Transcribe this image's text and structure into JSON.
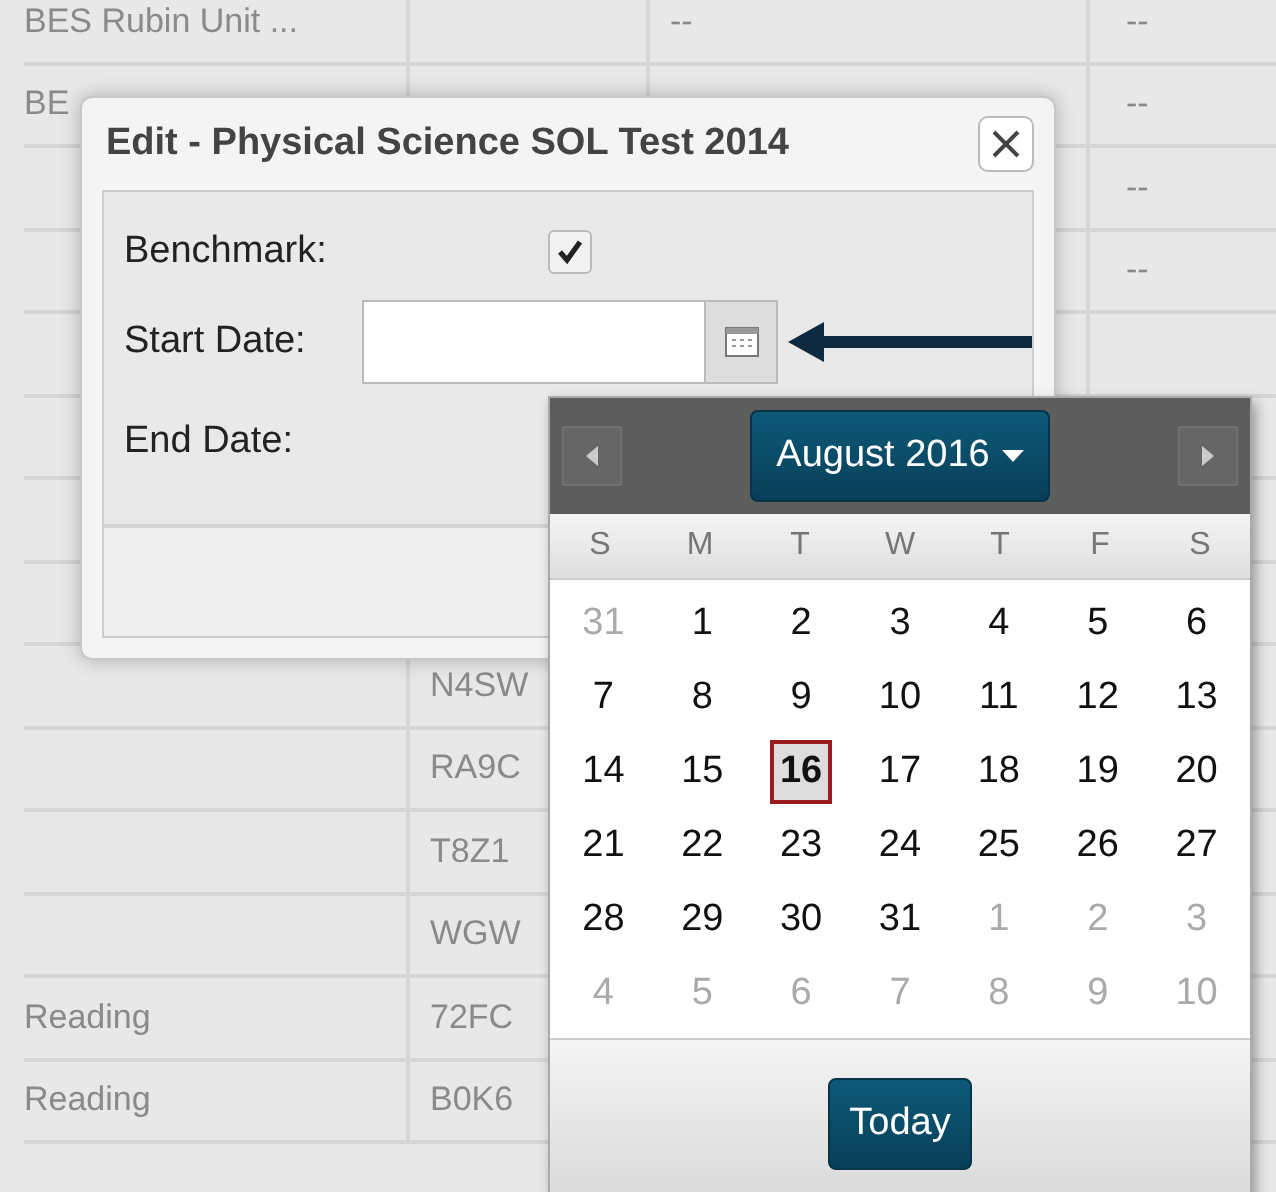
{
  "table": {
    "rows": [
      {
        "cells": [
          "BES Rubin Unit ...",
          "",
          "--",
          "--"
        ]
      },
      {
        "cells": [
          "BE",
          "",
          "",
          "--"
        ]
      },
      {
        "cells": [
          "",
          "",
          "",
          "--"
        ]
      },
      {
        "cells": [
          "",
          "",
          "",
          "--"
        ]
      },
      {
        "cells": [
          "",
          "",
          "",
          ""
        ]
      },
      {
        "cells": [
          "",
          "",
          "",
          ""
        ]
      },
      {
        "cells": [
          "",
          "",
          "",
          ""
        ]
      },
      {
        "cells": [
          "",
          "",
          "",
          ""
        ]
      },
      {
        "cells": [
          "",
          "N4SW",
          "",
          ""
        ]
      },
      {
        "cells": [
          "",
          "RA9C",
          "",
          ""
        ]
      },
      {
        "cells": [
          "",
          "T8Z1",
          "",
          ""
        ]
      },
      {
        "cells": [
          "",
          "WGW",
          "",
          ""
        ]
      },
      {
        "cells": [
          "Reading",
          "72FC",
          "",
          ""
        ]
      },
      {
        "cells": [
          "Reading",
          "B0K6",
          "",
          ""
        ]
      }
    ]
  },
  "dialog": {
    "title": "Edit - Physical Science SOL Test 2014",
    "fields": [
      {
        "kind": "checkbox",
        "label": "Benchmark:",
        "checked": true
      },
      {
        "kind": "date",
        "label": "Start Date:"
      },
      {
        "kind": "text",
        "label": "End Date:"
      }
    ]
  },
  "datepicker": {
    "month": "August 2016",
    "weekdays": [
      "S",
      "M",
      "T",
      "W",
      "T",
      "F",
      "S"
    ],
    "days": [
      {
        "label": "31",
        "other_month": true,
        "selected": false
      },
      {
        "label": "1",
        "other_month": false,
        "selected": false
      },
      {
        "label": "2",
        "other_month": false,
        "selected": false
      },
      {
        "label": "3",
        "other_month": false,
        "selected": false
      },
      {
        "label": "4",
        "other_month": false,
        "selected": false
      },
      {
        "label": "5",
        "other_month": false,
        "selected": false
      },
      {
        "label": "6",
        "other_month": false,
        "selected": false
      },
      {
        "label": "7",
        "other_month": false,
        "selected": false
      },
      {
        "label": "8",
        "other_month": false,
        "selected": false
      },
      {
        "label": "9",
        "other_month": false,
        "selected": false
      },
      {
        "label": "10",
        "other_month": false,
        "selected": false
      },
      {
        "label": "11",
        "other_month": false,
        "selected": false
      },
      {
        "label": "12",
        "other_month": false,
        "selected": false
      },
      {
        "label": "13",
        "other_month": false,
        "selected": false
      },
      {
        "label": "14",
        "other_month": false,
        "selected": false
      },
      {
        "label": "15",
        "other_month": false,
        "selected": false
      },
      {
        "label": "16",
        "other_month": false,
        "selected": true
      },
      {
        "label": "17",
        "other_month": false,
        "selected": false
      },
      {
        "label": "18",
        "other_month": false,
        "selected": false
      },
      {
        "label": "19",
        "other_month": false,
        "selected": false
      },
      {
        "label": "20",
        "other_month": false,
        "selected": false
      },
      {
        "label": "21",
        "other_month": false,
        "selected": false
      },
      {
        "label": "22",
        "other_month": false,
        "selected": false
      },
      {
        "label": "23",
        "other_month": false,
        "selected": false
      },
      {
        "label": "24",
        "other_month": false,
        "selected": false
      },
      {
        "label": "25",
        "other_month": false,
        "selected": false
      },
      {
        "label": "26",
        "other_month": false,
        "selected": false
      },
      {
        "label": "27",
        "other_month": false,
        "selected": false
      },
      {
        "label": "28",
        "other_month": false,
        "selected": false
      },
      {
        "label": "29",
        "other_month": false,
        "selected": false
      },
      {
        "label": "30",
        "other_month": false,
        "selected": false
      },
      {
        "label": "31",
        "other_month": false,
        "selected": false
      },
      {
        "label": "1",
        "other_month": true,
        "selected": false
      },
      {
        "label": "2",
        "other_month": true,
        "selected": false
      },
      {
        "label": "3",
        "other_month": true,
        "selected": false
      },
      {
        "label": "4",
        "other_month": true,
        "selected": false
      },
      {
        "label": "5",
        "other_month": true,
        "selected": false
      },
      {
        "label": "6",
        "other_month": true,
        "selected": false
      },
      {
        "label": "7",
        "other_month": true,
        "selected": false
      },
      {
        "label": "8",
        "other_month": true,
        "selected": false
      },
      {
        "label": "9",
        "other_month": true,
        "selected": false
      },
      {
        "label": "10",
        "other_month": true,
        "selected": false
      }
    ],
    "today_button": "Today"
  }
}
